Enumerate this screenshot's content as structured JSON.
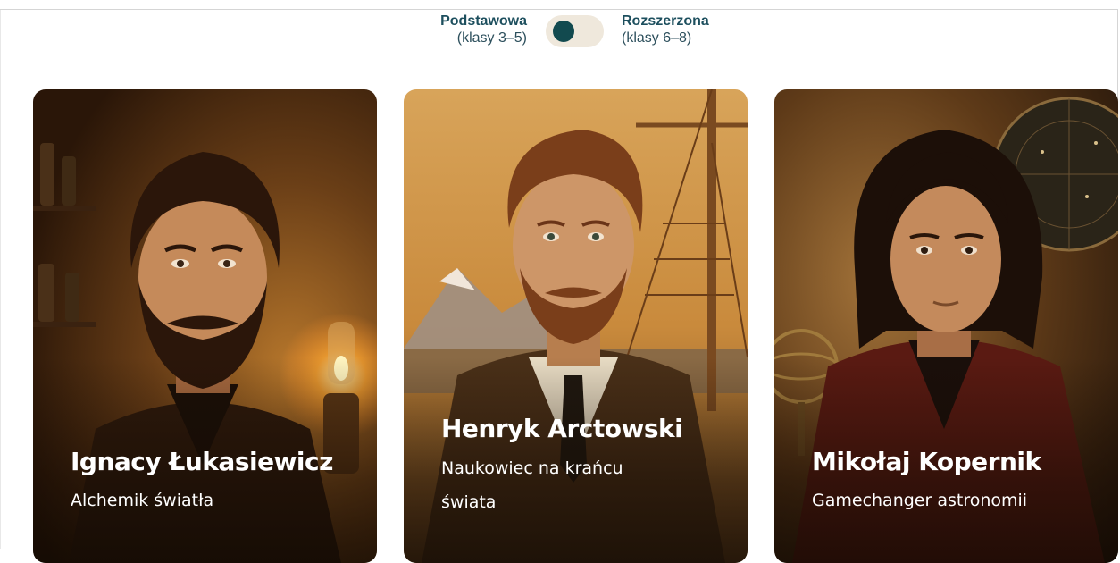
{
  "level_switch": {
    "basic": {
      "title": "Podstawowa",
      "subtitle": "(klasy 3–5)"
    },
    "extended": {
      "title": "Rozszerzona",
      "subtitle": "(klasy 6–8)"
    },
    "selected": "basic"
  },
  "cards": [
    {
      "name": "Ignacy Łukasiewicz",
      "tagline": "Alchemik światła",
      "portrait_icon": "portrait-lukasiewicz-icon"
    },
    {
      "name": "Henryk Arctowski",
      "tagline_line1": "Naukowiec na krańcu",
      "tagline_line2": "świata",
      "portrait_icon": "portrait-arctowski-icon"
    },
    {
      "name": "Mikołaj Kopernik",
      "tagline": "Gamechanger astronomii",
      "portrait_icon": "portrait-kopernik-icon"
    }
  ],
  "colors": {
    "toggle_track": "#efe8dc",
    "toggle_knob": "#124a4f",
    "label_text": "#1d4f5e"
  }
}
